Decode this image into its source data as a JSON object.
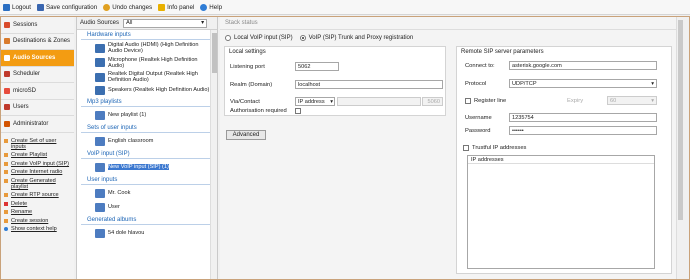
{
  "toolbar": {
    "items": [
      {
        "label": "Logout",
        "icon": "logout-icon",
        "color": "#2b6fc2"
      },
      {
        "label": "Save configuration",
        "icon": "save-icon",
        "color": "#3a66b0"
      },
      {
        "label": "Undo changes",
        "icon": "undo-icon",
        "color": "#e0a020"
      },
      {
        "label": "Info panel",
        "icon": "info-icon",
        "color": "#e8b000"
      },
      {
        "label": "Help",
        "icon": "help-icon",
        "color": "#2f7dd6"
      }
    ]
  },
  "nav": {
    "items": [
      {
        "label": "Sessions",
        "icon": "sessions-icon",
        "color": "#d94b2b"
      },
      {
        "label": "Destinations & Zones",
        "icon": "destinations-icon",
        "color": "#d97b2b"
      },
      {
        "label": "Audio Sources",
        "icon": "audio-sources-icon",
        "color": "#ffffff"
      },
      {
        "label": "Scheduler",
        "icon": "scheduler-icon",
        "color": "#c0392b"
      },
      {
        "label": "microSD",
        "icon": "microsd-icon",
        "color": "#e74c3c"
      },
      {
        "label": "Users",
        "icon": "users-icon",
        "color": "#c0392b"
      },
      {
        "label": "Administrator",
        "icon": "administrator-icon",
        "color": "#d35400"
      }
    ],
    "active_index": 2,
    "accent": "#f39c12",
    "links": [
      "Create Set of user inputs",
      "Create Playlist",
      "Create VoIP input (SIP)",
      "Create Internet radio",
      "Create Generated playlist",
      "Create RTP source",
      "Delete",
      "Rename",
      "Create session",
      "Show context help"
    ]
  },
  "left_panel": {
    "header_label": "Audio Sources",
    "filter_value": "All",
    "sections": [
      {
        "title": "Hardware inputs",
        "items": [
          "Digital Audio (HDMI) (High Definition Audio Device)",
          "Microphone (Realtek High Definition Audio)",
          "Realtek Digital Output (Realtek High Definition Audio)",
          "Speakers (Realtek High Definition Audio)"
        ]
      },
      {
        "title": "Mp3 playlists",
        "items": [
          "New playlist (1)"
        ]
      },
      {
        "title": "Sets of user inputs",
        "items": [
          "English classroom"
        ]
      },
      {
        "title": "VoIP input (SIP)",
        "items": [
          "New VoIP input (SIP) (1)"
        ]
      },
      {
        "title": "User inputs",
        "items": [
          "Mr. Cook",
          "User"
        ]
      },
      {
        "title": "Generated albums",
        "items": [
          "54 dole hlavou"
        ]
      }
    ],
    "selected_item": "New VoIP input (SIP) (1)"
  },
  "right_panel": {
    "tab_label": "Stack status",
    "radio_local": "Local VoIP input (SIP)",
    "radio_trunk": "VoIP (SIP) Trunk and Proxy registration",
    "selected_radio": "trunk",
    "local": {
      "title": "Local settings",
      "listening_port_label": "Listening port",
      "listening_port": "5062",
      "realm_label": "Realm (Domain)",
      "realm": "localhost",
      "via_label": "Via/Contact",
      "via_mode": "IP address",
      "via_port": "5060",
      "auth_label": "Authorisation required",
      "advanced_label": "Advanced"
    },
    "remote": {
      "title": "Remote SIP server parameters",
      "connect_label": "Connect to:",
      "connect": "asterisk.google.com",
      "protocol_label": "Protocol",
      "protocol": "UDP/TCP",
      "register_label": "Register line",
      "expiry_label": "Expiry",
      "expiry": "60",
      "username_label": "Username",
      "username": "1235754",
      "password_label": "Password",
      "password": "••••••",
      "trustful_label": "Trustful IP addresses",
      "ip_header": "IP addresses"
    }
  }
}
